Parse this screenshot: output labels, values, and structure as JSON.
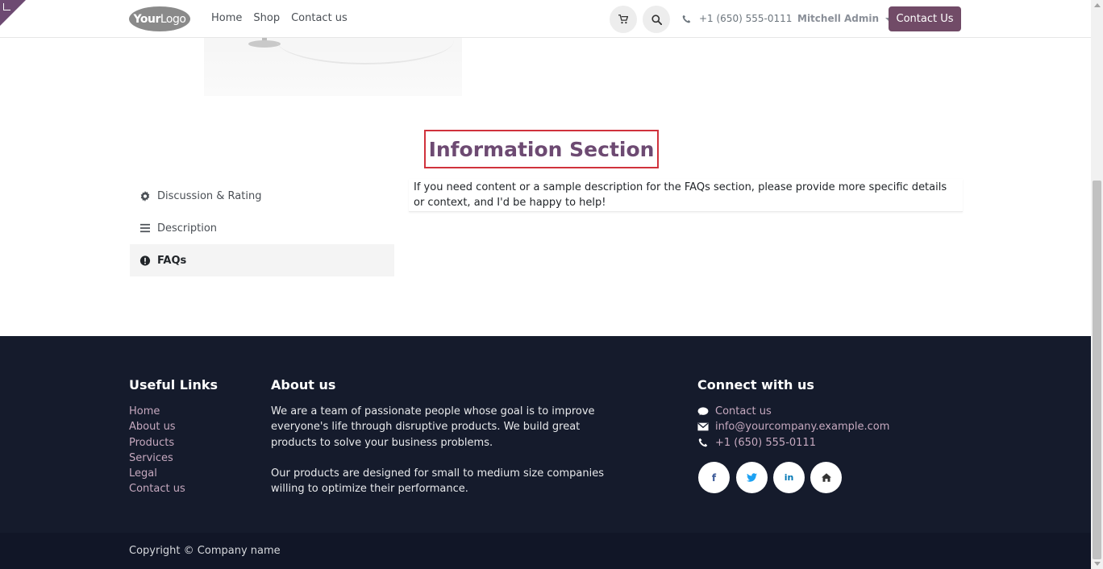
{
  "header": {
    "logo_main": "Your",
    "logo_light": "Logo",
    "nav": [
      "Home",
      "Shop",
      "Contact us"
    ],
    "cart_icon": "cart-icon",
    "search_icon": "search-icon",
    "phone": "+1 (650) 555-0111",
    "user": "Mitchell Admin",
    "contact_button": "Contact Us"
  },
  "info_section": {
    "title": "Information Section"
  },
  "tabs": [
    {
      "label": "Discussion & Rating",
      "icon": "gear-icon"
    },
    {
      "label": "Description",
      "icon": "list-icon"
    },
    {
      "label": "FAQs",
      "icon": "exclamation-circle-icon",
      "active": true
    }
  ],
  "tab_content": "If you need content or a sample description for the FAQs section, please provide more specific details or context, and I'd be happy to help!",
  "footer": {
    "useful_links_title": "Useful Links",
    "useful_links": [
      "Home",
      "About us",
      "Products",
      "Services",
      "Legal",
      "Contact us"
    ],
    "about_title": "About us",
    "about_p1": "We are a team of passionate people whose goal is to improve everyone's life through disruptive products. We build great products to solve your business problems.",
    "about_p2": "Our products are designed for small to medium size companies willing to optimize their performance.",
    "connect_title": "Connect with us",
    "connect_contact": "Contact us",
    "connect_email": "info@yourcompany.example.com",
    "connect_phone": "+1 (650) 555-0111",
    "social": [
      "facebook-icon",
      "twitter-icon",
      "linkedin-icon",
      "home-icon"
    ]
  },
  "copyright": "Copyright © Company name",
  "colors": {
    "brand": "#714b67",
    "title": "#6d4a72",
    "highlight_border": "#d0323c",
    "footer_bg": "#151b2c",
    "footer_link": "#c6a9bf"
  }
}
